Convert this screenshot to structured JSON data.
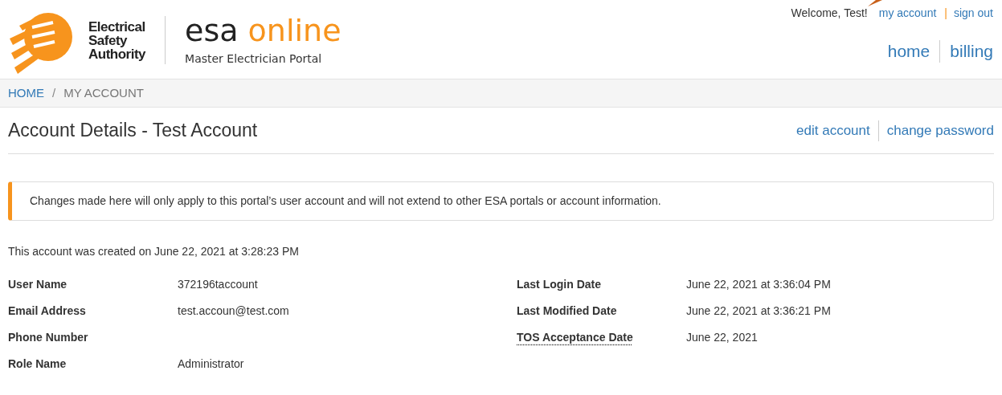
{
  "logo": {
    "org_lines": [
      "Electrical",
      "Safety",
      "Authority"
    ],
    "product_prefix": "esa",
    "product_suffix": "online",
    "subtitle": "Master Electrician Portal"
  },
  "user_nav": {
    "welcome": "Welcome, Test!",
    "links": [
      "my account",
      "sign out"
    ],
    "separator": "|"
  },
  "main_nav": [
    "home",
    "billing"
  ],
  "breadcrumb": {
    "items": [
      "HOME",
      "MY ACCOUNT"
    ],
    "separator": "/"
  },
  "page_title": "Account Details - Test Account",
  "actions": [
    "edit account",
    "change password"
  ],
  "alert": "Changes made here will only apply to this portal’s user account and will not extend to other ESA portals or account information.",
  "created_note": "This account was created on June 22, 2021 at 3:28:23 PM",
  "fields_left": [
    {
      "label": "User Name",
      "value": "372196taccount",
      "abbreviation": false
    },
    {
      "label": "Email Address",
      "value": "test.accoun@test.com",
      "abbreviation": false
    },
    {
      "label": "Phone Number",
      "abbreviation": false
    },
    {
      "label": "Role Name",
      "value": "Administrator",
      "abbreviation": false
    }
  ],
  "fields_right": [
    {
      "label": "Last Login Date",
      "value": "June 22, 2021 at 3:36:04 PM",
      "abbreviation": false
    },
    {
      "label": "Last Modified Date",
      "value": "June 22, 2021 at 3:36:21 PM",
      "abbreviation": false
    },
    {
      "label": "TOS Acceptance Date",
      "value": "June 22, 2021",
      "abbreviation": true
    }
  ]
}
